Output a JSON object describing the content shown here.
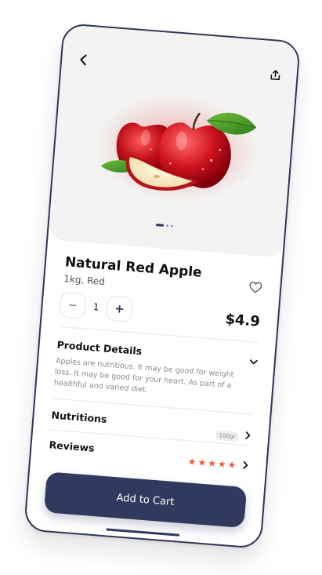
{
  "product": {
    "title": "Natural Red Apple",
    "subtitle": "1kg, Red",
    "quantity": "1",
    "price": "$4.9"
  },
  "sections": {
    "details_title": "Product Details",
    "details_text": "Apples are nutritious. It may be good for weight loss. It may be good for your heart. As part of a healthful and varied diet.",
    "nutritions_title": "Nutritions",
    "nutritions_badge": "100gr",
    "reviews_title": "Reviews",
    "rating": 5
  },
  "actions": {
    "add_to_cart": "Add to Cart"
  },
  "carousel": {
    "slides": 3,
    "active_index": 0
  },
  "colors": {
    "accent": "#313a5e",
    "star": "#f05a3c",
    "hero_bg": "#f2f3f2"
  },
  "icons": {
    "back": "back-chevron-icon",
    "share": "share-icon",
    "favorite": "heart-icon",
    "decrease": "minus-icon",
    "increase": "plus-icon",
    "expand": "chevron-down-icon",
    "navigate": "chevron-right-icon",
    "rating": "star-icon"
  }
}
